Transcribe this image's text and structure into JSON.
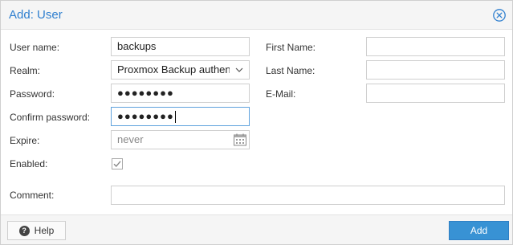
{
  "dialog": {
    "title": "Add: User"
  },
  "form": {
    "user_name_label": "User name:",
    "user_name_value": "backups",
    "realm_label": "Realm:",
    "realm_value": "Proxmox Backup authentication server",
    "password_label": "Password:",
    "password_value": "●●●●●●●●",
    "confirm_password_label": "Confirm password:",
    "confirm_password_value": "●●●●●●●●",
    "expire_label": "Expire:",
    "expire_placeholder": "never",
    "enabled_label": "Enabled:",
    "enabled_checked": true,
    "first_name_label": "First Name:",
    "first_name_value": "",
    "last_name_label": "Last Name:",
    "last_name_value": "",
    "email_label": "E-Mail:",
    "email_value": "",
    "comment_label": "Comment:",
    "comment_value": ""
  },
  "footer": {
    "help_label": "Help",
    "add_label": "Add"
  },
  "colors": {
    "title": "#2f7fcf",
    "primary_button": "#3892d4",
    "focus_border": "#5fa2dd"
  },
  "icons": {
    "close": "close-circle-icon",
    "calendar": "calendar-icon",
    "help": "question-circle-icon",
    "dropdown": "chevron-down-icon",
    "check": "checkmark-icon"
  }
}
